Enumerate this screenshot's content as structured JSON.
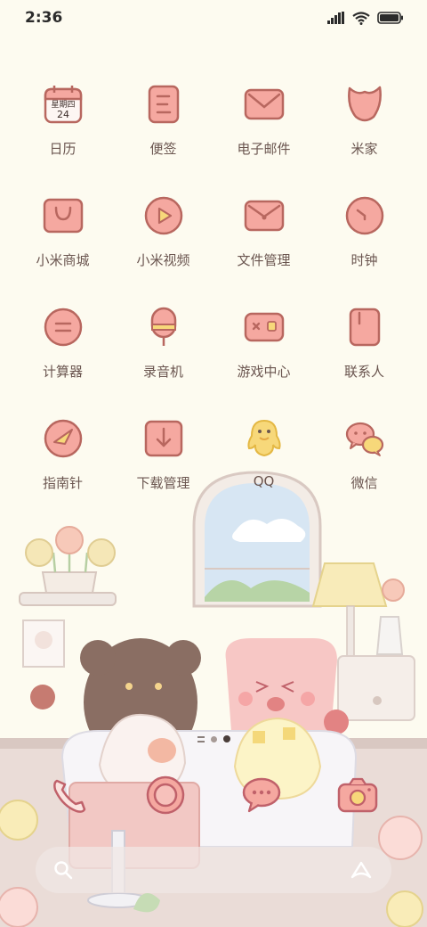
{
  "status_bar": {
    "time": "2:36"
  },
  "apps": [
    {
      "label": "日历",
      "icon": "calendar-icon",
      "calendar_weekday": "星期四",
      "calendar_day": "24"
    },
    {
      "label": "便签",
      "icon": "notes-icon"
    },
    {
      "label": "电子邮件",
      "icon": "mail-icon"
    },
    {
      "label": "米家",
      "icon": "mijia-icon"
    },
    {
      "label": "小米商城",
      "icon": "shopping-bag-icon"
    },
    {
      "label": "小米视频",
      "icon": "video-play-icon"
    },
    {
      "label": "文件管理",
      "icon": "folder-icon"
    },
    {
      "label": "时钟",
      "icon": "clock-icon"
    },
    {
      "label": "计算器",
      "icon": "calculator-icon"
    },
    {
      "label": "录音机",
      "icon": "microphone-icon"
    },
    {
      "label": "游戏中心",
      "icon": "gamepad-icon"
    },
    {
      "label": "联系人",
      "icon": "contacts-icon"
    },
    {
      "label": "指南针",
      "icon": "compass-icon"
    },
    {
      "label": "下载管理",
      "icon": "download-icon"
    },
    {
      "label": "QQ",
      "icon": "qq-penguin-icon"
    },
    {
      "label": "微信",
      "icon": "wechat-icon"
    }
  ],
  "page_indicator": {
    "total_pages": 2,
    "current_page": 2
  },
  "dock": [
    {
      "name": "phone",
      "icon": "phone-icon"
    },
    {
      "name": "browser",
      "icon": "browser-icon"
    },
    {
      "name": "messages",
      "icon": "message-icon"
    },
    {
      "name": "camera",
      "icon": "camera-icon"
    }
  ],
  "search": {
    "left_icon": "search-icon",
    "right_icon": "assistant-icon"
  },
  "colors": {
    "icon_fill": "#f5a8a0",
    "icon_stroke": "#b8675f",
    "accent_yellow": "#f7d87a",
    "background": "#fdfbf0"
  }
}
